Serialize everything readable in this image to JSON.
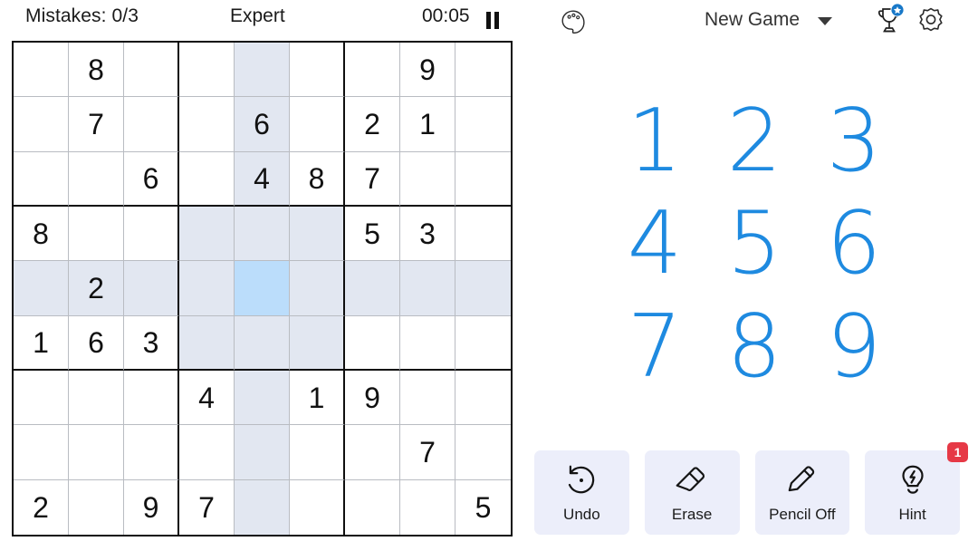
{
  "status": {
    "mistakes_label": "Mistakes: 0/3",
    "difficulty": "Expert",
    "timer": "00:05",
    "pause_icon": "pause-icon"
  },
  "topbar": {
    "palette_icon": "palette-icon",
    "new_game_label": "New Game",
    "caret_icon": "chevron-down-icon",
    "trophy_icon": "trophy-icon",
    "trophy_badge_icon": "star-badge-icon",
    "settings_icon": "gear-icon"
  },
  "numpad": {
    "keys": [
      "1",
      "2",
      "3",
      "4",
      "5",
      "6",
      "7",
      "8",
      "9"
    ]
  },
  "actions": [
    {
      "label": "Undo",
      "icon": "undo-icon",
      "badge": ""
    },
    {
      "label": "Erase",
      "icon": "eraser-icon",
      "badge": ""
    },
    {
      "label": "Pencil Off",
      "icon": "pencil-icon",
      "badge": ""
    },
    {
      "label": "Hint",
      "icon": "lightbulb-icon",
      "badge": "1"
    }
  ],
  "colors": {
    "accent_blue": "#1e8ae0",
    "selected_cell": "#bbddfb",
    "peer_cell": "#e2e7f1",
    "action_bg": "#eceefa",
    "badge_red": "#e63946",
    "grid_line": "#b9bcc2",
    "grid_bold": "#0f0f0f"
  },
  "board": {
    "selected": {
      "row": 5,
      "col": 5
    },
    "rows": [
      [
        "",
        "8",
        "",
        "",
        "",
        "",
        "",
        "9",
        ""
      ],
      [
        "",
        "7",
        "",
        "",
        "6",
        "",
        "2",
        "1",
        ""
      ],
      [
        "",
        "",
        "6",
        "",
        "4",
        "8",
        "7",
        "",
        ""
      ],
      [
        "8",
        "",
        "",
        "",
        "",
        "",
        "5",
        "3",
        ""
      ],
      [
        "",
        "2",
        "",
        "",
        "",
        "",
        "",
        "",
        ""
      ],
      [
        "1",
        "6",
        "3",
        "",
        "",
        "",
        "",
        "",
        ""
      ],
      [
        "",
        "",
        "",
        "4",
        "",
        "1",
        "9",
        "",
        ""
      ],
      [
        "",
        "",
        "",
        "",
        "",
        "",
        "",
        "7",
        ""
      ],
      [
        "2",
        "",
        "9",
        "7",
        "",
        "",
        "",
        "",
        "5"
      ]
    ]
  }
}
